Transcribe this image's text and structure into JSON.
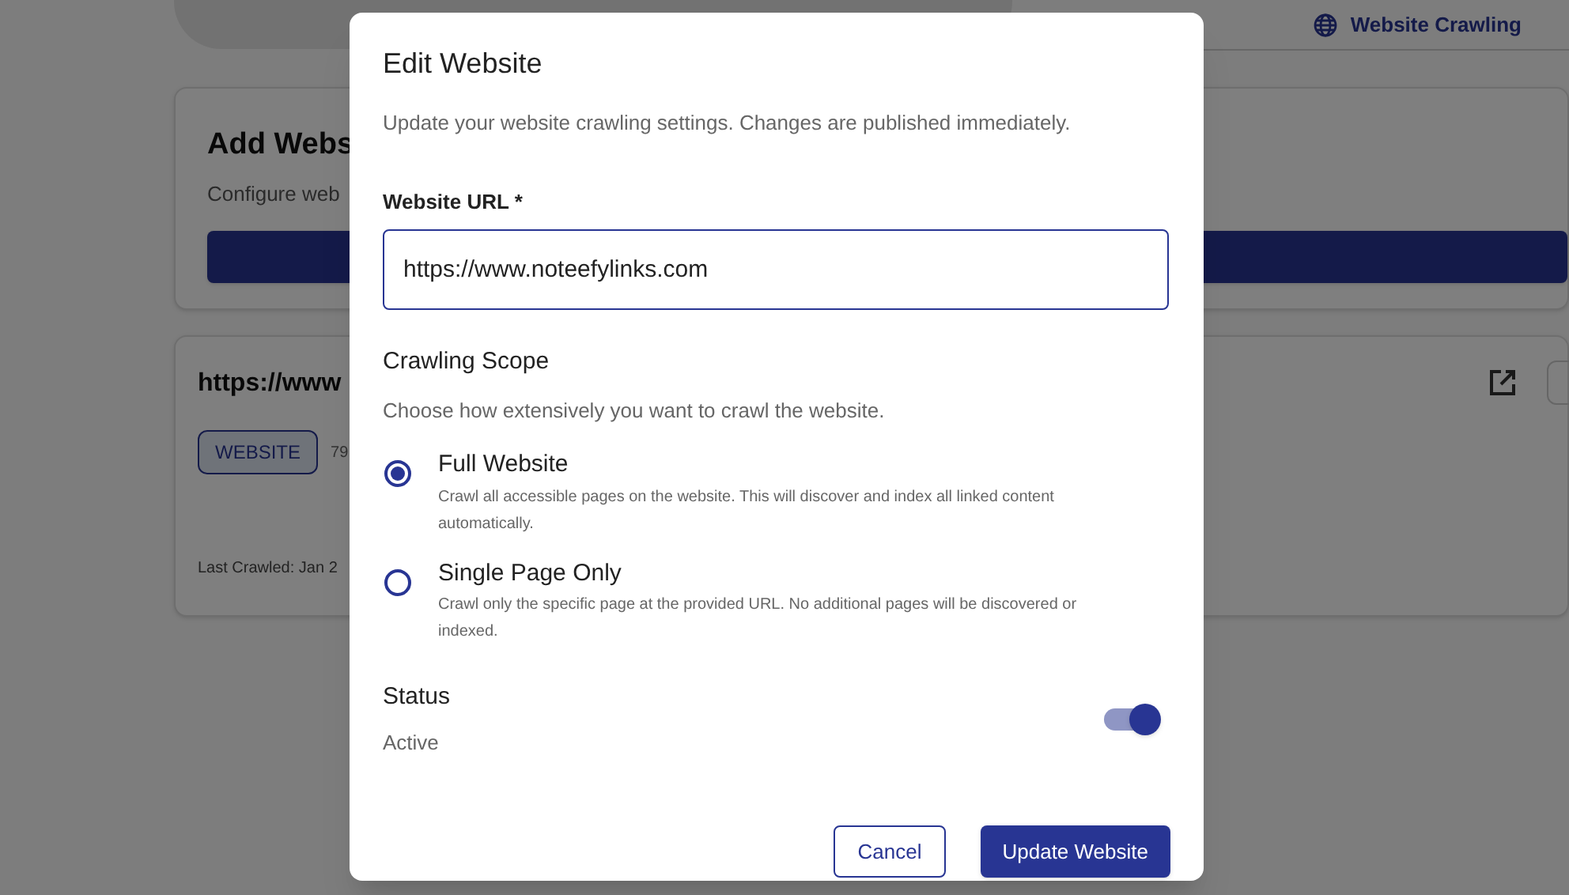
{
  "background_page": {
    "tab": {
      "label": "Website Crawling",
      "selected": true
    },
    "add_card": {
      "title": "Add Webs",
      "subtitle": "Configure web"
    },
    "website_card": {
      "title": "https://www",
      "badge": "WEBSITE",
      "count": "79",
      "last_crawled": "Last Crawled: Jan 2"
    }
  },
  "dialog": {
    "title": "Edit Website",
    "subtitle": "Update your website crawling settings. Changes are published immediately.",
    "url_field": {
      "label": "Website URL *",
      "value": "https://www.noteefylinks.com"
    },
    "scope": {
      "title": "Crawling Scope",
      "description": "Choose how extensively you want to crawl the website.",
      "options": [
        {
          "label": "Full Website",
          "description": "Crawl all accessible pages on the website. This will discover and index all linked content automatically.",
          "selected": true
        },
        {
          "label": "Single Page Only",
          "description": "Crawl only the specific page at the provided URL. No additional pages will be discovered or indexed.",
          "selected": false
        }
      ]
    },
    "status": {
      "label": "Status",
      "value": "Active",
      "on": true
    },
    "buttons": [
      {
        "label": "Cancel",
        "kind": "secondary"
      },
      {
        "label": "Update Website",
        "kind": "primary"
      }
    ]
  }
}
